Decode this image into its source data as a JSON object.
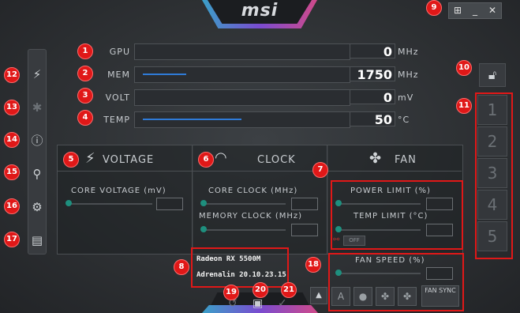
{
  "brand": "msi",
  "window": {
    "windows_icon": "windows-icon",
    "minimize": "_",
    "close": "✕"
  },
  "monitor": {
    "rows": [
      {
        "label": "GPU",
        "value": "0",
        "unit": "MHz"
      },
      {
        "label": "MEM",
        "value": "1750",
        "unit": "MHz"
      },
      {
        "label": "VOLT",
        "value": "0",
        "unit": "mV"
      },
      {
        "label": "TEMP",
        "value": "50",
        "unit": "°C"
      }
    ]
  },
  "panels": {
    "voltage": {
      "title": "VOLTAGE",
      "core_voltage": "CORE VOLTAGE (mV)"
    },
    "clock": {
      "title": "CLOCK",
      "core_clock": "CORE CLOCK (MHz)",
      "memory_clock": "MEMORY CLOCK (MHz)"
    },
    "fan": {
      "title": "FAN",
      "power_limit": "POWER LIMIT (%)",
      "temp_limit": "TEMP LIMIT (°C)",
      "off": "OFF",
      "fan_speed": "FAN SPEED (%)",
      "fan_sync": "FAN SYNC"
    }
  },
  "gpu_info": {
    "name": "Radeon RX 5500M",
    "driver": "Adrenalin 20.10.23.15"
  },
  "profiles": [
    "1",
    "2",
    "3",
    "4",
    "5"
  ],
  "badges": [
    "1",
    "2",
    "3",
    "4",
    "5",
    "6",
    "7",
    "8",
    "9",
    "10",
    "11",
    "12",
    "13",
    "14",
    "15",
    "16",
    "17",
    "18",
    "19",
    "20",
    "21"
  ],
  "colors": {
    "accent": "#1e8f7e",
    "badge": "#e01818",
    "bar_fill": "#2f7bd8"
  }
}
